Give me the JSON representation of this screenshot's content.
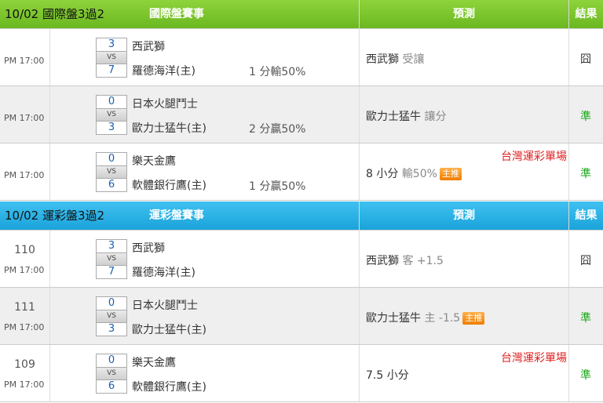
{
  "section1": {
    "date_title": "10/02 國際盤3過2",
    "match_header": "國際盤賽事",
    "pred_header": "預測",
    "result_header": "結果",
    "rows": [
      {
        "time": "PM 17:00",
        "score_a": "3",
        "score_b": "7",
        "vs": "VS",
        "team_a": "西武獅",
        "team_b": "羅德海洋(主)",
        "line": "1 分輸50%",
        "pred": "西武獅",
        "pred_sub": "受讓",
        "tag": "",
        "note": "",
        "result": "囧"
      },
      {
        "time": "PM 17:00",
        "score_a": "0",
        "score_b": "3",
        "vs": "VS",
        "team_a": "日本火腿鬥士",
        "team_b": "歐力士猛牛(主)",
        "line": "2 分贏50%",
        "pred": "歐力士猛牛",
        "pred_sub": "讓分",
        "tag": "",
        "note": "",
        "result": "準"
      },
      {
        "time": "PM 17:00",
        "score_a": "0",
        "score_b": "6",
        "vs": "VS",
        "team_a": "樂天金鷹",
        "team_b": "軟體銀行鷹(主)",
        "line": "1 分贏50%",
        "pred": "8 小分",
        "pred_sub": "輸50%",
        "tag": "主推",
        "note": "台灣運彩單場",
        "result": "準"
      }
    ]
  },
  "section2": {
    "date_title": "10/02 運彩盤3過2",
    "match_header": "運彩盤賽事",
    "pred_header": "預測",
    "result_header": "結果",
    "rows": [
      {
        "num": "110",
        "time": "PM 17:00",
        "score_a": "3",
        "score_b": "7",
        "vs": "VS",
        "team_a": "西武獅",
        "team_b": "羅德海洋(主)",
        "pred": "西武獅",
        "pred_sub": "客 +1.5",
        "tag": "",
        "note": "",
        "result": "囧"
      },
      {
        "num": "111",
        "time": "PM 17:00",
        "score_a": "0",
        "score_b": "3",
        "vs": "VS",
        "team_a": "日本火腿鬥士",
        "team_b": "歐力士猛牛(主)",
        "pred": "歐力士猛牛",
        "pred_sub": "主 -1.5",
        "tag": "主推",
        "note": "",
        "result": "準"
      },
      {
        "num": "109",
        "time": "PM 17:00",
        "score_a": "0",
        "score_b": "6",
        "vs": "VS",
        "team_a": "樂天金鷹",
        "team_b": "軟體銀行鷹(主)",
        "pred": "7.5 小分",
        "pred_sub": "",
        "tag": "",
        "note": "台灣運彩單場",
        "result": "準"
      }
    ]
  },
  "colors": {
    "header1": "#7cc52c",
    "header2": "#2cb2e6",
    "result_ok": "#17a717",
    "note": "#e02020",
    "tag": "#f28c1a"
  }
}
